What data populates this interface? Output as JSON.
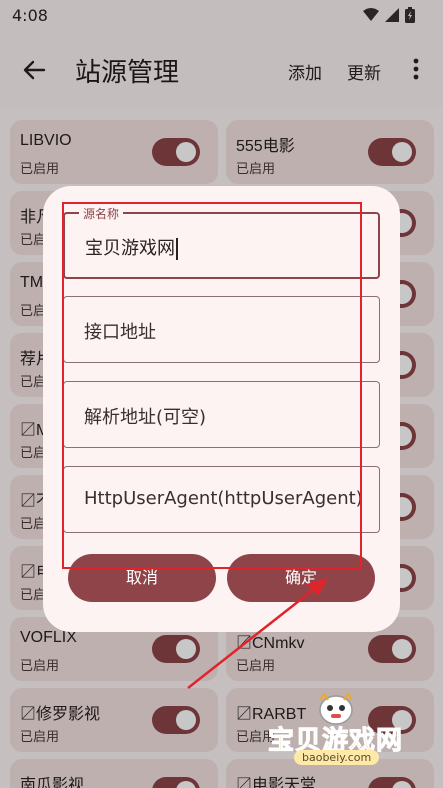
{
  "status_bar": {
    "time": "4:08"
  },
  "app_bar": {
    "title": "站源管理",
    "add_label": "添加",
    "update_label": "更新"
  },
  "sources": [
    {
      "name": "LIBVIO",
      "status": "已启用",
      "enabled": true
    },
    {
      "name": "555电影",
      "status": "已启用",
      "enabled": true
    },
    {
      "name": "非凡",
      "status": "已启用",
      "enabled": true
    },
    {
      "name": "",
      "status": "",
      "enabled": true
    },
    {
      "name": "TM",
      "status": "已启用",
      "enabled": true
    },
    {
      "name": "",
      "status": "",
      "enabled": true
    },
    {
      "name": "荐片",
      "status": "已启用",
      "enabled": true
    },
    {
      "name": "",
      "status": "",
      "enabled": true
    },
    {
      "name": "〼M",
      "status": "已启用",
      "enabled": true
    },
    {
      "name": "",
      "status": "",
      "enabled": true
    },
    {
      "name": "〼不",
      "status": "已启用",
      "enabled": true
    },
    {
      "name": "",
      "status": "",
      "enabled": true
    },
    {
      "name": "〼电",
      "status": "已启用",
      "enabled": true
    },
    {
      "name": "",
      "status": "",
      "enabled": true
    },
    {
      "name": "VOFLIX",
      "status": "已启用",
      "enabled": true
    },
    {
      "name": "〼CNmkv",
      "status": "已启用",
      "enabled": true
    },
    {
      "name": "〼修罗影视",
      "status": "已启用",
      "enabled": true
    },
    {
      "name": "〼RARBT",
      "status": "已启用",
      "enabled": true
    },
    {
      "name": "南瓜影视",
      "status": "",
      "enabled": true
    },
    {
      "name": "〼电影天堂",
      "status": "",
      "enabled": true
    }
  ],
  "dialog": {
    "name_field": {
      "legend": "源名称",
      "value": "宝贝游戏网"
    },
    "api_field": {
      "placeholder": "接口地址"
    },
    "parse_field": {
      "placeholder": "解析地址(可空)"
    },
    "ua_field": {
      "placeholder": "HttpUserAgent(httpUserAgent)"
    },
    "cancel_label": "取消",
    "confirm_label": "确定"
  },
  "watermark": {
    "text": "宝贝游戏网",
    "url": "baobeiy.com"
  },
  "colors": {
    "primary": "#8e4448",
    "card_bg": "#f3e2e1",
    "annotation_red": "#e0242b",
    "watermark_gold": "#f2a71f"
  }
}
